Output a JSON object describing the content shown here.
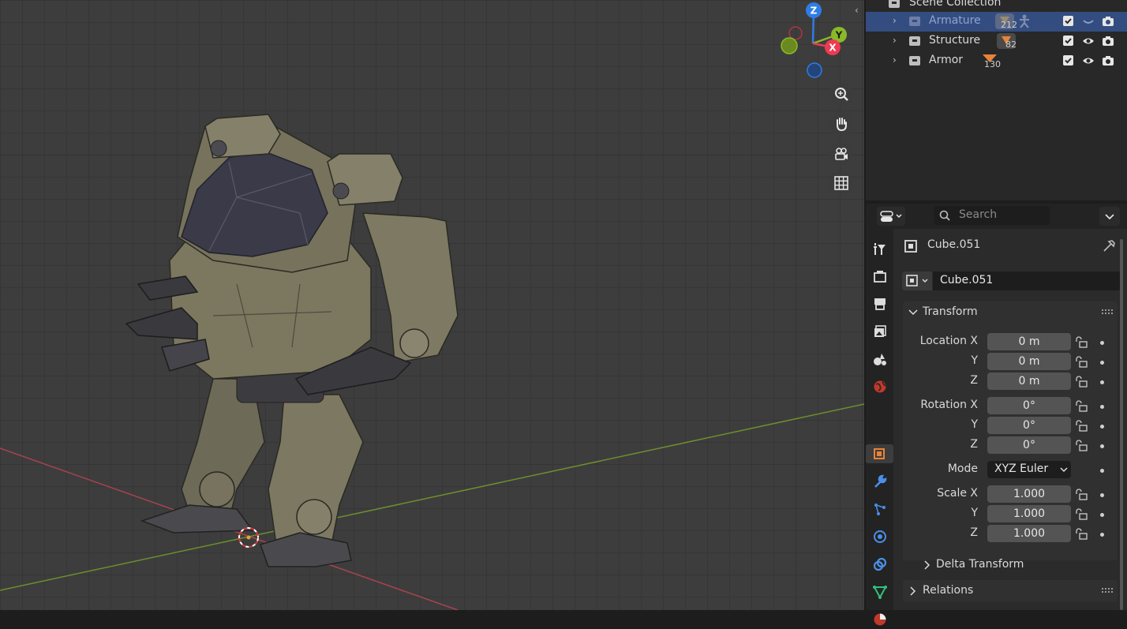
{
  "viewport": {
    "gizmo": {
      "z": "Z",
      "y": "Y",
      "x": "X"
    },
    "nav_buttons": [
      "zoom-icon",
      "hand-pan-icon",
      "camera-icon",
      "grid-icon"
    ]
  },
  "outliner": {
    "root": "Scene Collection",
    "rows": [
      {
        "name": "Armature",
        "count": "212"
      },
      {
        "name": "Structure",
        "count": "82"
      },
      {
        "name": "Armor",
        "count": "130"
      }
    ]
  },
  "properties": {
    "search_placeholder": "Search",
    "object_name": "Cube.051",
    "datablock_name": "Cube.051",
    "transform_title": "Transform",
    "location_label": "Location X",
    "rotation_label": "Rotation X",
    "scale_label": "Scale X",
    "y_label": "Y",
    "z_label": "Z",
    "location": [
      "0 m",
      "0 m",
      "0 m"
    ],
    "rotation": [
      "0°",
      "0°",
      "0°"
    ],
    "mode_label": "Mode",
    "mode_value": "XYZ Euler",
    "scale": [
      "1.000",
      "1.000",
      "1.000"
    ],
    "delta_transform": "Delta Transform",
    "relations": "Relations"
  },
  "colors": {
    "active_row": "#334d80",
    "accent_orange": "#e8833a",
    "axis_x": "#ee3a52",
    "axis_y": "#8ab927",
    "axis_z": "#2f7ce6"
  }
}
